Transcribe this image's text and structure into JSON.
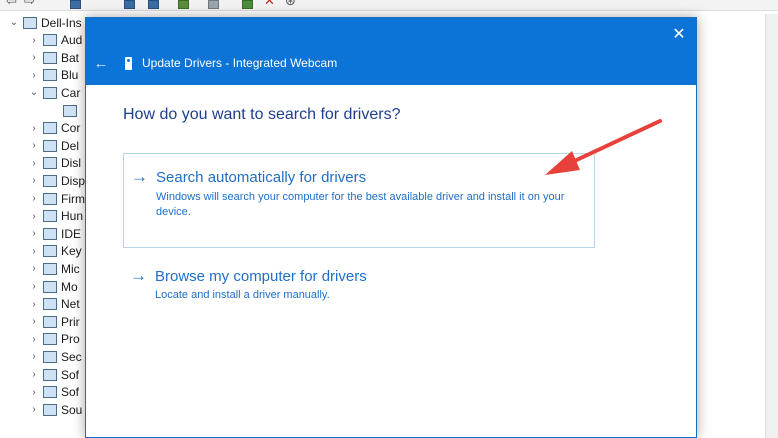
{
  "device_manager": {
    "tree": [
      {
        "label": "Dell-Ins",
        "level": "root",
        "expander": "⌄",
        "icon": "computer-icon"
      },
      {
        "label": "Aud",
        "level": "child",
        "expander": "›",
        "icon": "speaker-icon"
      },
      {
        "label": "Bat",
        "level": "child",
        "expander": "›",
        "icon": "battery-icon"
      },
      {
        "label": "Blu",
        "level": "child",
        "expander": "›",
        "icon": "bluetooth-icon"
      },
      {
        "label": "Car",
        "level": "child",
        "expander": "⌄",
        "icon": "camera-icon"
      },
      {
        "label": "",
        "level": "grandchild",
        "expander": "",
        "icon": "webcam-icon"
      },
      {
        "label": "Cor",
        "level": "child",
        "expander": "›",
        "icon": "monitor-icon"
      },
      {
        "label": "Del",
        "level": "child",
        "expander": "›",
        "icon": "monitor-icon"
      },
      {
        "label": "Disl",
        "level": "child",
        "expander": "›",
        "icon": "disk-icon"
      },
      {
        "label": "Disp",
        "level": "child",
        "expander": "›",
        "icon": "display-icon"
      },
      {
        "label": "Firm",
        "level": "child",
        "expander": "›",
        "icon": "firmware-icon"
      },
      {
        "label": "Hun",
        "level": "child",
        "expander": "›",
        "icon": "hid-icon"
      },
      {
        "label": "IDE",
        "level": "child",
        "expander": "›",
        "icon": "ide-icon"
      },
      {
        "label": "Key",
        "level": "child",
        "expander": "›",
        "icon": "keyboard-icon"
      },
      {
        "label": "Mic",
        "level": "child",
        "expander": "›",
        "icon": "mouse-icon"
      },
      {
        "label": "Mo",
        "level": "child",
        "expander": "›",
        "icon": "monitor-icon"
      },
      {
        "label": "Net",
        "level": "child",
        "expander": "›",
        "icon": "network-icon"
      },
      {
        "label": "Prir",
        "level": "child",
        "expander": "›",
        "icon": "printer-icon"
      },
      {
        "label": "Pro",
        "level": "child",
        "expander": "›",
        "icon": "processor-icon"
      },
      {
        "label": "Sec",
        "level": "child",
        "expander": "›",
        "icon": "security-icon"
      },
      {
        "label": "Sof",
        "level": "child",
        "expander": "›",
        "icon": "software-icon"
      },
      {
        "label": "Sof",
        "level": "child",
        "expander": "›",
        "icon": "software-icon"
      },
      {
        "label": "Sou",
        "level": "child",
        "expander": "›",
        "icon": "sound-icon"
      }
    ]
  },
  "dialog": {
    "title": "Update Drivers - Integrated Webcam",
    "back_glyph": "←",
    "close_glyph": "✕",
    "question": "How do you want to search for drivers?",
    "options": [
      {
        "arrow": "→",
        "title": "Search automatically for drivers",
        "description": "Windows will search your computer for the best available driver and install it on your device."
      },
      {
        "arrow": "→",
        "title": "Browse my computer for drivers",
        "description": "Locate and install a driver manually."
      }
    ]
  },
  "colors": {
    "header_blue": "#0b74d6",
    "link_blue": "#1f6fc8",
    "annotation_red": "#e8403a"
  }
}
